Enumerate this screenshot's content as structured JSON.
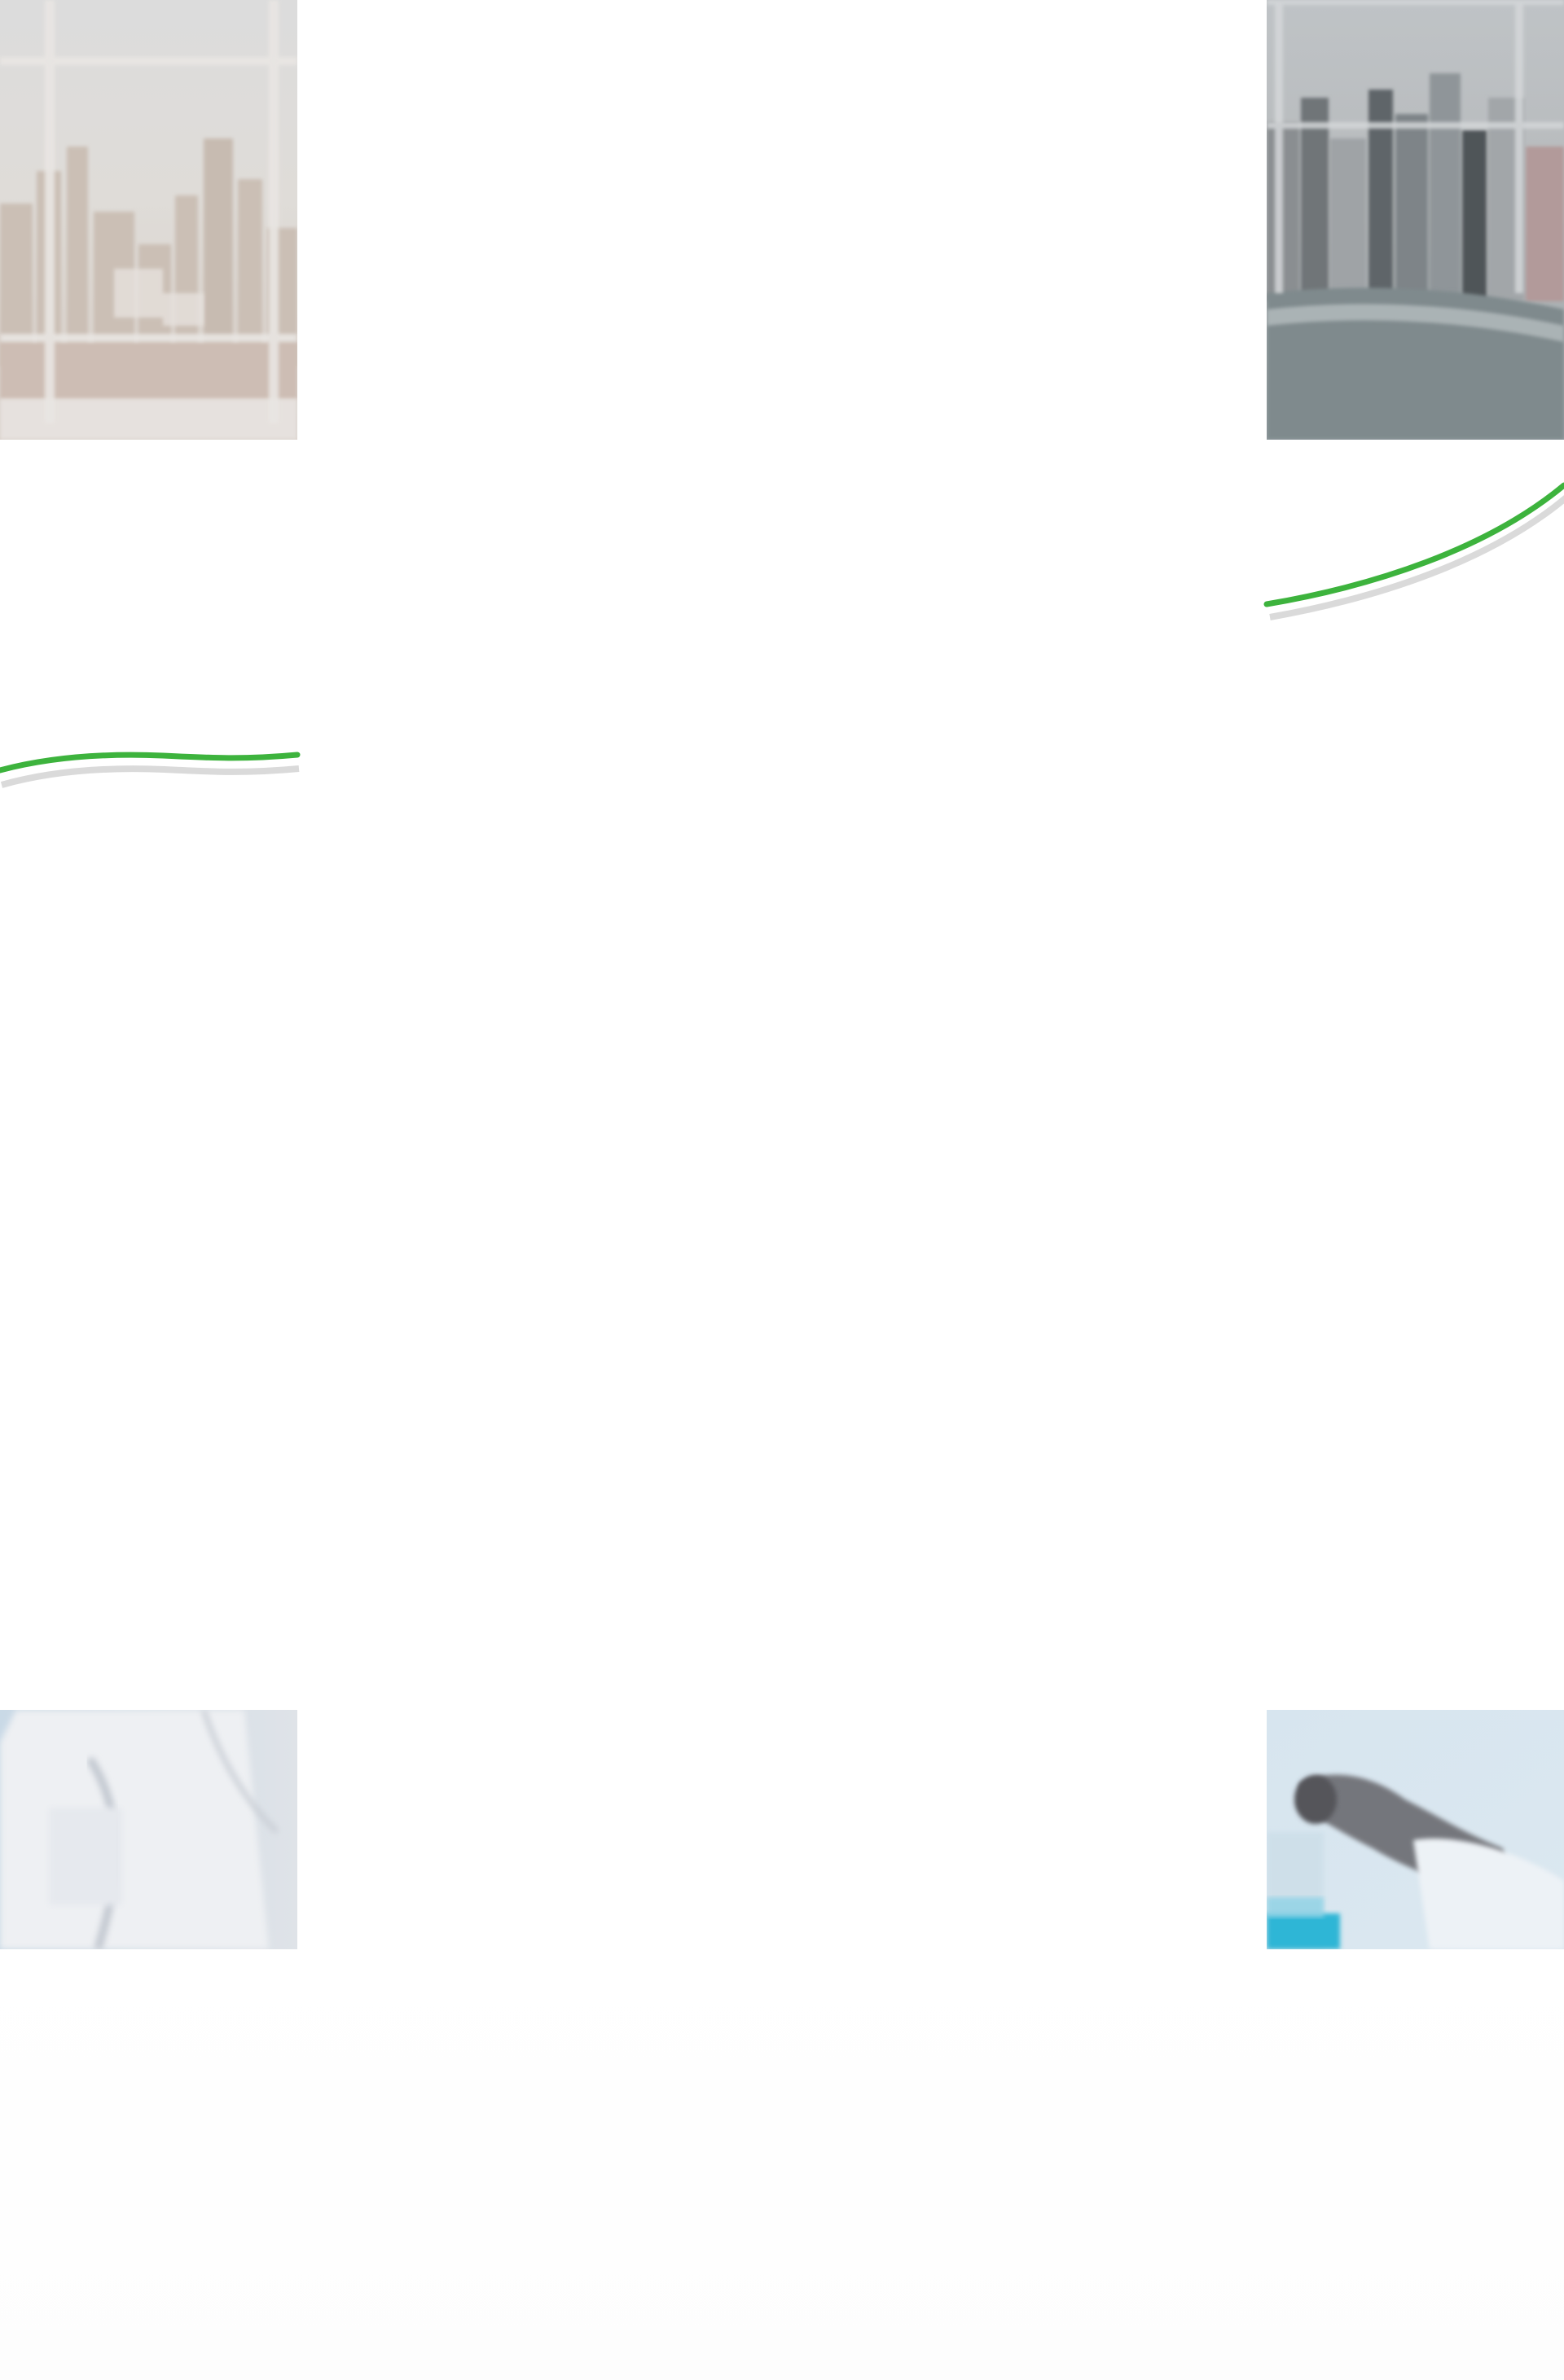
{
  "page": {
    "background": "#ffffff"
  },
  "colors": {
    "accent_curve": "#3db33d",
    "curve_shadow": "#d9d9d9"
  },
  "images": {
    "top_left": "city-skyline-window-photo",
    "top_right": "city-buildings-window-photo",
    "bottom_left": "lab-coat-photo",
    "bottom_right": "lab-beaker-hand-photo"
  }
}
